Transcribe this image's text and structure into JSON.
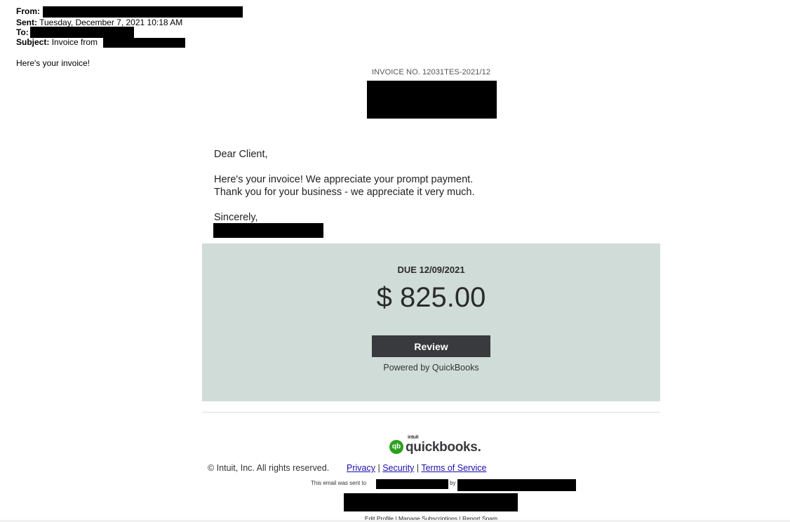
{
  "email_header": {
    "from_label": "From:",
    "sent_label": "Sent:",
    "sent_value": "Tuesday, December 7, 2021 10:18 AM",
    "to_label": "To:",
    "subject_label": "Subject:",
    "subject_value": "Invoice from"
  },
  "intro_text": "Here's your invoice!",
  "invoice": {
    "number_text": "INVOICE NO. 12031TES-2021/12"
  },
  "letter": {
    "greeting": "Dear Client,",
    "body_line1": "Here's your invoice! We appreciate your prompt payment.",
    "body_line2": "Thank you for your business - we appreciate it very much.",
    "closing": "Sincerely,"
  },
  "payment": {
    "due_label": "DUE 12/09/2021",
    "amount": "$ 825.00",
    "review_label": "Review",
    "powered_by": "Powered by QuickBooks",
    "panel_color": "#d0dcd8",
    "button_color": "#393a3d"
  },
  "footer": {
    "logo_icon": "qb",
    "logo_intuit": "intuit",
    "logo_text": "quickbooks.",
    "copyright": "© Intuit, Inc. All rights reserved.",
    "privacy": "Privacy",
    "security": "Security",
    "terms": "Terms of Service",
    "sep": "|",
    "sent_to_prefix": "This email was sent to",
    "sent_to_by": "by",
    "edit_profile": "Edit Profile",
    "manage_subscriptions": "Manage Subscriptions",
    "report_spam": "Report Spam",
    "brand_green": "#2ca01c",
    "link_color": "#1a0dab"
  }
}
